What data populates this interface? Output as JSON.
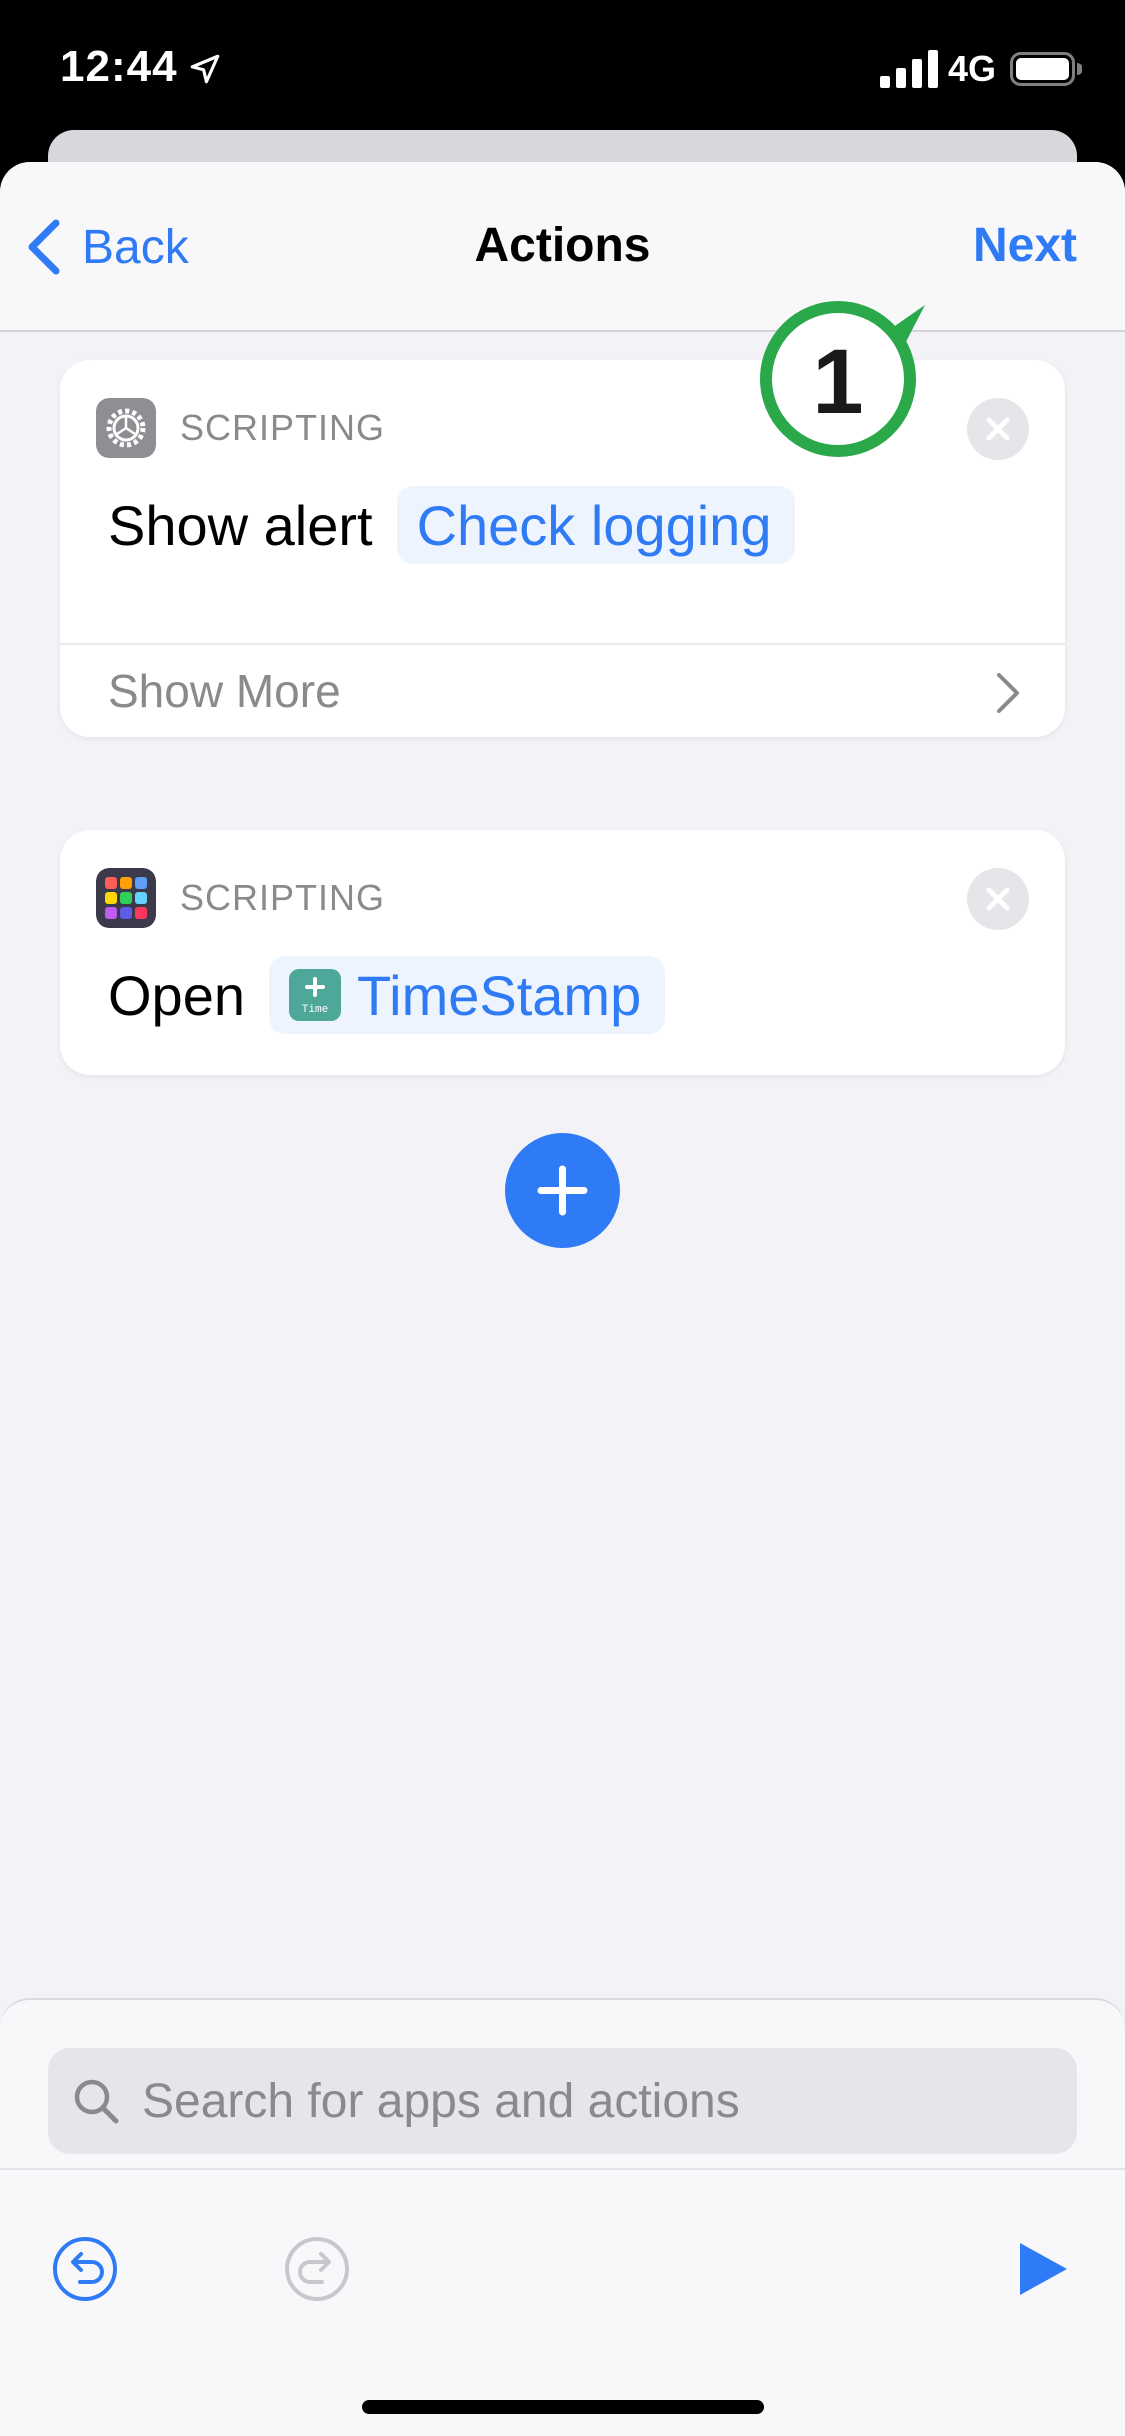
{
  "status_bar": {
    "time": "12:44",
    "network": "4G"
  },
  "nav": {
    "back_label": "Back",
    "title": "Actions",
    "next_label": "Next"
  },
  "annotation": {
    "number": "1",
    "color": "#2aa84a"
  },
  "actions": [
    {
      "category": "SCRIPTING",
      "verb": "Show alert",
      "parameter": "Check logging",
      "show_more_label": "Show More",
      "icon": "settings-gear-icon"
    },
    {
      "category": "SCRIPTING",
      "verb": "Open",
      "parameter": "TimeStamp",
      "icon": "app-grid-icon",
      "parameter_icon": "timestamp-app-icon",
      "parameter_icon_text": "Time"
    }
  ],
  "search": {
    "placeholder": "Search for apps and actions"
  },
  "colors": {
    "accent": "#2f7bf5",
    "background": "#f2f2f7",
    "annotation": "#2aa84a"
  }
}
